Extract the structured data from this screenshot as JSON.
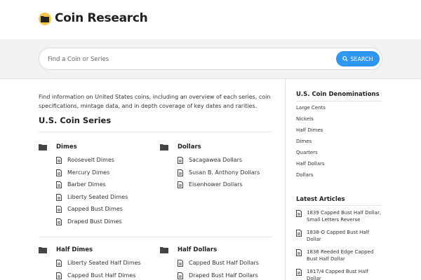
{
  "header": {
    "site_name": "Coin Research"
  },
  "search": {
    "placeholder": "Find a Coin or Series",
    "button_label": "SEARCH"
  },
  "intro_text": "Find information on United States coins, including an overview of each series, coin specifications, mintage data, and in depth coverage of key dates and rarities.",
  "series_section": {
    "title": "U.S. Coin Series",
    "groups": [
      {
        "title": "Dimes",
        "items": [
          "Roosevelt Dimes",
          "Mercury Dimes",
          "Barber Dimes",
          "Liberty Seated Dimes",
          "Capped Bust Dimes",
          "Draped Bust Dimes"
        ]
      },
      {
        "title": "Dollars",
        "items": [
          "Sacagawea Dollars",
          "Susan B. Anthony Dollars",
          "Eisenhower Dollars"
        ]
      },
      {
        "title": "Half Dimes",
        "items": [
          "Liberty Seated Half Dimes",
          "Capped Bust Half Dimes"
        ]
      },
      {
        "title": "Half Dollars",
        "items": [
          "Capped Bust Half Dollars",
          "Draped Bust Half Dollars"
        ]
      }
    ]
  },
  "sidebar": {
    "denominations_title": "U.S. Coin Denominations",
    "denominations": [
      "Large Cents",
      "Nickels",
      "Half Dimes",
      "Dimes",
      "Quarters",
      "Half Dollars",
      "Dollars"
    ],
    "articles_title": "Latest Articles",
    "articles": [
      "1839 Capped Bust Half Dollar, Small Letters Reverse",
      "1838-O Capped Bust Half Dollar",
      "1836 Reeded Edge Capped Bust Half Dollar",
      "1817/4 Capped Bust Half Dollar"
    ]
  },
  "colors": {
    "accent": "#2f97f0",
    "logo": "#f2c84b",
    "band": "#f2f2f2"
  }
}
